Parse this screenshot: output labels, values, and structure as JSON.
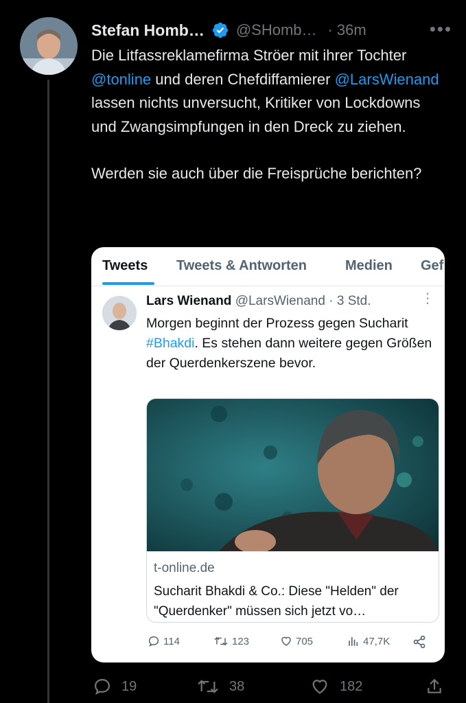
{
  "tweet": {
    "author_name": "Stefan Homb…",
    "handle": "@SHomb…",
    "separator": "·",
    "time": "36m",
    "more_label": "•••",
    "text_part1": "Die Litfassreklamefirma Ströer mit ihrer Tochter ",
    "mention1": "@tonline",
    "text_part2": " und deren Chefdiffamierer ",
    "mention2": "@LarsWienand",
    "text_part3": " lassen nichts unversucht, Kritiker von Lockdowns und Zwangsimpfungen in den Dreck zu ziehen.",
    "text_paragraph2": "Werden sie auch über die Freisprüche berichten?",
    "actions": {
      "replies": "19",
      "retweets": "38",
      "likes": "182"
    }
  },
  "screenshot": {
    "tabs": [
      "Tweets",
      "Tweets & Antworten",
      "Medien",
      "Gef"
    ],
    "author_name": "Lars Wienand",
    "handle": "@LarsWienand",
    "separator": "·",
    "time": "3 Std.",
    "more_label": "⋮",
    "text_part1": "Morgen beginnt der Prozess gegen Sucharit ",
    "hashtag": "#Bhakdi",
    "text_part2": ". Es stehen dann weitere gegen Größen der Querdenkerszene bevor.",
    "link_domain": "t-online.de",
    "link_title": "Sucharit Bhakdi & Co.: Diese \"Helden\" der \"Querdenker\" müssen sich jetzt vo…",
    "actions": {
      "replies": "114",
      "retweets": "123",
      "likes": "705",
      "views": "47,7K"
    }
  },
  "icons": {
    "verified": "verified-badge-icon",
    "reply": "reply-icon",
    "retweet": "retweet-icon",
    "like": "heart-icon",
    "views": "views-icon",
    "share": "share-icon"
  },
  "colors": {
    "background": "#000000",
    "accent": "#1d9bf0",
    "muted": "#71767b",
    "text": "#e7e9ea"
  }
}
